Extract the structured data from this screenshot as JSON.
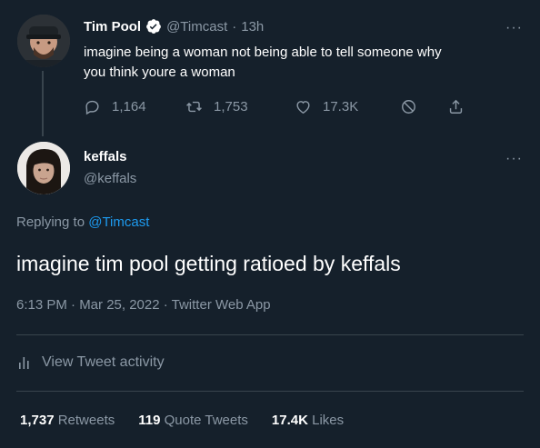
{
  "original_tweet": {
    "display_name": "Tim Pool",
    "handle": "@Timcast",
    "time_ago": "13h",
    "text_line1": "imagine being a woman not being able to tell someone why",
    "text_line2": "you think youre a woman",
    "replies": "1,164",
    "retweets": "1,753",
    "likes": "17.3K"
  },
  "reply_tweet": {
    "display_name": "keffals",
    "handle": "@keffals",
    "replying_prefix": "Replying to",
    "replying_to": "@Timcast",
    "text": "imagine tim pool getting ratioed by keffals",
    "timestamp": "6:13 PM · Mar 25, 2022 · Twitter Web App"
  },
  "activity": {
    "label": "View Tweet activity"
  },
  "stats": {
    "retweets_count": "1,737",
    "retweets_label": "Retweets",
    "quotes_count": "119",
    "quotes_label": "Quote Tweets",
    "likes_count": "17.4K",
    "likes_label": "Likes"
  },
  "colors": {
    "background": "#15202b",
    "accent": "#1d9bf0",
    "muted": "#8b98a5",
    "divider": "#38444d"
  }
}
